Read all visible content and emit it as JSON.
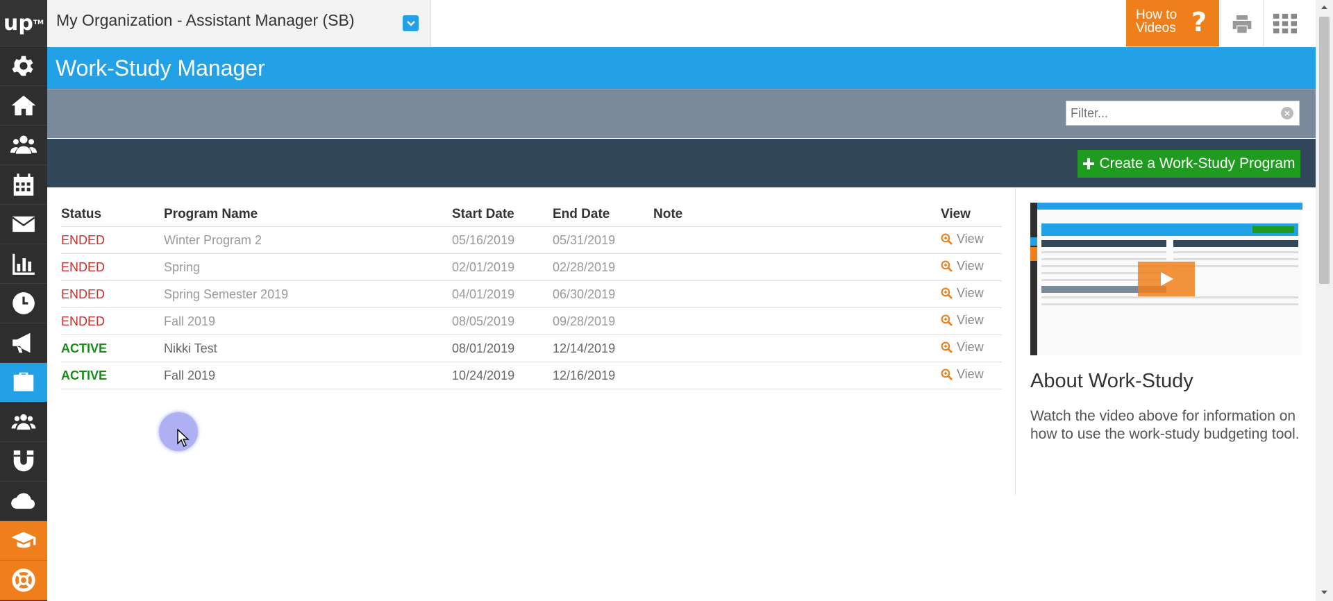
{
  "brand": {
    "logo_text": "up",
    "logo_tm": "TM"
  },
  "sidebar": {
    "items": [
      {
        "icon": "gear-icon"
      },
      {
        "icon": "home-icon"
      },
      {
        "icon": "users-icon"
      },
      {
        "icon": "calendar-icon"
      },
      {
        "icon": "envelope-icon"
      },
      {
        "icon": "bar-chart-icon"
      },
      {
        "icon": "clock-icon"
      },
      {
        "icon": "megaphone-icon"
      },
      {
        "icon": "briefcase-icon",
        "active": true
      },
      {
        "icon": "group-icon"
      },
      {
        "icon": "magnet-icon"
      },
      {
        "icon": "cloud-icon"
      },
      {
        "icon": "graduation-cap-icon",
        "accent": "#ee7f1b"
      },
      {
        "icon": "life-ring-icon",
        "accent": "#ee7f1b"
      }
    ]
  },
  "header": {
    "org_label": "My Organization - Assistant Manager (SB)",
    "howto_line1": "How to",
    "howto_line2": "Videos",
    "howto_symbol": "?"
  },
  "page": {
    "title": "Work-Study Manager"
  },
  "filter": {
    "placeholder": "Filter...",
    "value": ""
  },
  "actions": {
    "create_label": "Create a Work-Study Program"
  },
  "table": {
    "headers": {
      "status": "Status",
      "program": "Program Name",
      "start": "Start Date",
      "end": "End Date",
      "note": "Note",
      "view": "View"
    },
    "rows": [
      {
        "status": "ENDED",
        "program": "Winter Program 2",
        "start": "05/16/2019",
        "end": "05/31/2019",
        "note": "",
        "view": "View"
      },
      {
        "status": "ENDED",
        "program": "Spring",
        "start": "02/01/2019",
        "end": "02/28/2019",
        "note": "",
        "view": "View"
      },
      {
        "status": "ENDED",
        "program": "Spring Semester 2019",
        "start": "04/01/2019",
        "end": "06/30/2019",
        "note": "",
        "view": "View"
      },
      {
        "status": "ENDED",
        "program": "Fall 2019",
        "start": "08/05/2019",
        "end": "09/28/2019",
        "note": "",
        "view": "View"
      },
      {
        "status": "ACTIVE",
        "program": "Nikki Test",
        "start": "08/01/2019",
        "end": "12/14/2019",
        "note": "",
        "view": "View"
      },
      {
        "status": "ACTIVE",
        "program": "Fall 2019",
        "start": "10/24/2019",
        "end": "12/16/2019",
        "note": "",
        "view": "View"
      }
    ]
  },
  "aside": {
    "about_title": "About Work-Study",
    "about_text": "Watch the video above for information on how to use the work-study budgeting tool."
  },
  "colors": {
    "primary": "#22a1e6",
    "accent": "#ee7f1b",
    "success": "#1f9b1f",
    "ended": "#c9302c",
    "active": "#1a8a1a",
    "dark_band": "#33475b",
    "filter_band": "#7b8a9b"
  }
}
